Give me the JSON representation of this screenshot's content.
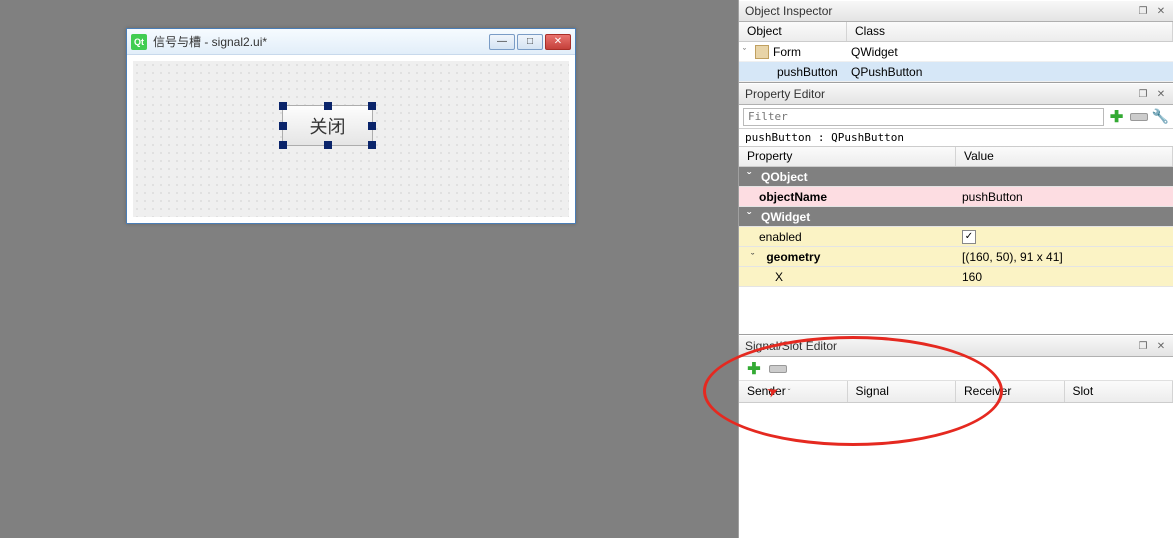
{
  "designWindow": {
    "title": "信号与槽 - signal2.ui*",
    "qtIcon": "Qt",
    "buttonLabel": "关闭"
  },
  "objectInspector": {
    "title": "Object Inspector",
    "columns": {
      "object": "Object",
      "class": "Class"
    },
    "rows": [
      {
        "name": "Form",
        "class": "QWidget",
        "hasChildren": true,
        "icon": "form"
      },
      {
        "name": "pushButton",
        "class": "QPushButton",
        "selected": true
      }
    ]
  },
  "propertyEditor": {
    "title": "Property Editor",
    "filterPlaceholder": "Filter",
    "selectedObject": "pushButton : QPushButton",
    "columns": {
      "property": "Property",
      "value": "Value"
    },
    "sections": {
      "qobject": "QObject",
      "qwidget": "QWidget"
    },
    "rows": {
      "objectName_label": "objectName",
      "objectName_value": "pushButton",
      "enabled_label": "enabled",
      "enabled_checked": "✓",
      "geometry_label": "geometry",
      "geometry_value": "[(160, 50), 91 x 41]",
      "x_label": "X",
      "x_value": "160"
    }
  },
  "signalSlotEditor": {
    "title": "Signal/Slot Editor",
    "columns": {
      "sender": "Sender",
      "signal": "Signal",
      "receiver": "Receiver",
      "slot": "Slot"
    }
  }
}
